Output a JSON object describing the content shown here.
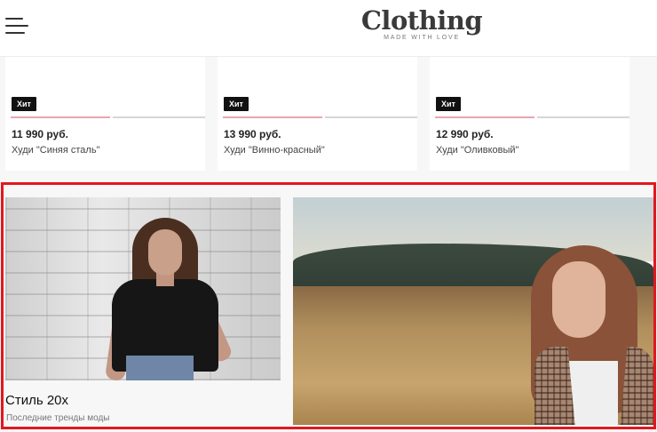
{
  "header": {
    "logo_title": "Clothing",
    "logo_subtitle": "MADE WITH LOVE"
  },
  "products": [
    {
      "badge": "Хит",
      "price": "11 990 руб.",
      "name": "Худи \"Синяя сталь\""
    },
    {
      "badge": "Хит",
      "price": "13 990 руб.",
      "name": "Худи \"Винно-красный\""
    },
    {
      "badge": "Хит",
      "price": "12 990 руб.",
      "name": "Худи \"Оливковый\""
    }
  ],
  "banners": {
    "left": {
      "title": "Стиль 20х",
      "subtitle": "Последние тренды моды"
    }
  },
  "colors": {
    "badge_bg": "#111111",
    "slider_active": "#e9a6ae",
    "selection_frame": "#e1181f"
  },
  "icons": {
    "menu": "hamburger-icon"
  }
}
